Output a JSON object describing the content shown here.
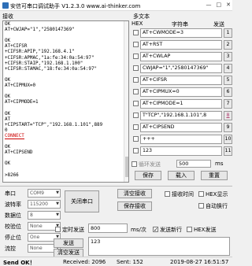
{
  "window": {
    "title": "安信可串口调试助手 V1.2.3.0    www.ai-thinker.com",
    "min": "—",
    "max": "□",
    "close": "✕"
  },
  "receive": {
    "label": "接收",
    "lines": [
      "OK",
      "AT+CWJAP=\"1\",\"2580147369\"",
      "",
      "OK",
      "AT+CIFSR",
      "+CIFSR:APIP,\"192.168.4.1\"",
      "+CIFSR:APMAC,\"1a:fe:34:0a:54:97\"",
      "+CIFSR:STAIP,\"192.168.1.100\"",
      "+CIFSR:STAMAC,\"18:fe:34:0a:54:97\"",
      "",
      "OK",
      "AT+CIPMUX=0",
      "",
      "OK",
      "AT+CIPMODE=1",
      "",
      "OK",
      "AT",
      "+CIPSTART=\"TCP\",\"192.168.1.101\",889",
      "0",
      "CONNECT",
      "",
      "OK",
      "AT+CIPSEND",
      "",
      "OK",
      "",
      ">8266"
    ]
  },
  "multi": {
    "label": "多文本",
    "hex_header": "HEX",
    "str_header": "字符串",
    "send_header": "发送",
    "rows": [
      {
        "text": "AT+CWMODE=3",
        "btn": "1"
      },
      {
        "text": "AT+RST",
        "btn": "2"
      },
      {
        "text": "AT+CWLAP",
        "btn": "3"
      },
      {
        "text": "CWJAP=\"1\",\"2580147369\"",
        "btn": "4"
      },
      {
        "text": "AT+CIFSR",
        "btn": "5"
      },
      {
        "text": "AT+CIPMUX=0",
        "btn": "6"
      },
      {
        "text": "AT+CIPMODE=1",
        "btn": "7"
      },
      {
        "text": "T\"TCP\",\"192.168.1.101\",8",
        "btn": "8"
      },
      {
        "text": "AT+CIPSEND",
        "btn": "9"
      },
      {
        "text": "+++",
        "btn": "10"
      },
      {
        "text": "123",
        "btn": "11"
      }
    ],
    "cycle_label": "循环发送",
    "cycle_value": "500",
    "cycle_unit": "ms",
    "save_label": "保存",
    "load_label": "载入",
    "reset_label": "重置"
  },
  "serial": {
    "port_label": "串口",
    "port_value": "COM9",
    "baud_label": "波特率",
    "baud_value": "115200",
    "data_label": "数据位",
    "data_value": "8",
    "parity_label": "校验位",
    "parity_value": "None",
    "stop_label": "停止位",
    "stop_value": "One",
    "flow_label": "流控",
    "flow_value": "None",
    "close_port_label": "关闭串口"
  },
  "recv_opts": {
    "clear_label": "清空接收",
    "save_label": "保存接收",
    "time_label": "接收时间",
    "hex_label": "HEX显示",
    "autowrap_label": "自动换行"
  },
  "send_opts": {
    "timed_label": "定时发送",
    "period_value": "800",
    "period_unit": "ms/次",
    "newline_label": "发送新行",
    "hex_label": "HEX发送",
    "send_label": "发送",
    "clear_label": "清空发送",
    "send_text": "123"
  },
  "status": {
    "send_ok": "Send OK！",
    "received": "Received: 2096",
    "sent": "Sent: 152",
    "datetime": "2019-08-27 16:51:57"
  }
}
